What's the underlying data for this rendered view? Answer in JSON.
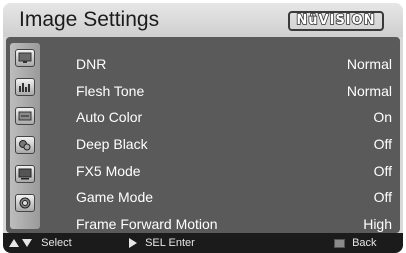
{
  "header": {
    "title": "Image Settings",
    "brand": "NüVision"
  },
  "sidebar": {
    "icons": [
      "picture-icon",
      "audio-eq-icon",
      "setup-icon",
      "color-icon",
      "display-icon",
      "power-icon"
    ]
  },
  "menu": {
    "rows": [
      {
        "label": "DNR",
        "value": "Normal"
      },
      {
        "label": "Flesh Tone",
        "value": "Normal"
      },
      {
        "label": "Auto Color",
        "value": "On"
      },
      {
        "label": "Deep Black",
        "value": "Off"
      },
      {
        "label": "FX5 Mode",
        "value": "Off"
      },
      {
        "label": "Game Mode",
        "value": "Off"
      },
      {
        "label": "Frame Forward Motion",
        "value": "High"
      }
    ]
  },
  "footer": {
    "select_label": "Select",
    "enter_label": "SEL Enter",
    "back_label": "Back"
  }
}
